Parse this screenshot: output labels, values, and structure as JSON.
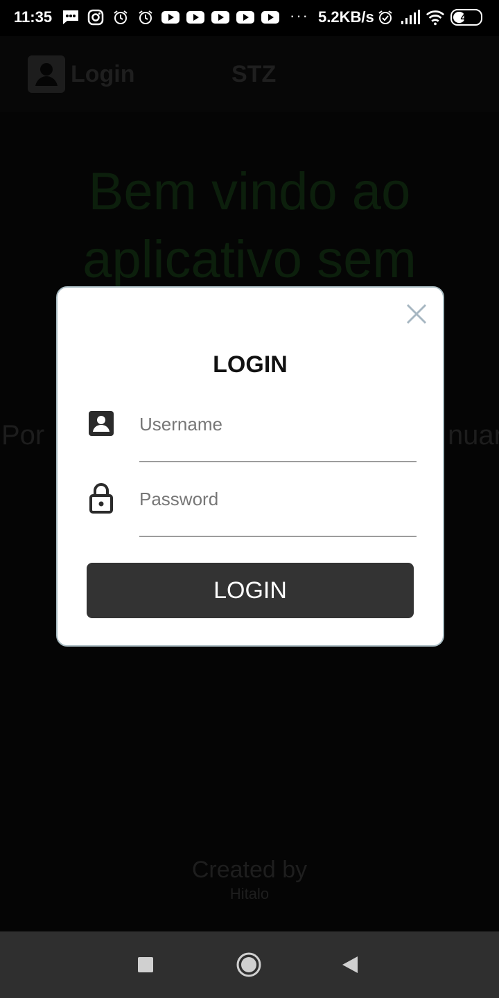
{
  "status_bar": {
    "time": "11:35",
    "network_speed": "5.2KB/s",
    "overflow": "···",
    "battery_level": "48",
    "notification_icons": [
      "message-icon",
      "instagram-icon",
      "alarm-icon",
      "alarm-icon",
      "youtube-icon",
      "youtube-icon",
      "youtube-icon",
      "youtube-icon",
      "youtube-icon"
    ]
  },
  "app": {
    "login_label": "Login",
    "title": "STZ",
    "welcome_line1": "Bem vindo ao",
    "welcome_line2": "aplicativo sem",
    "subtitle_left": "Por",
    "subtitle_right": "nuar",
    "credits_line1": "Created by",
    "credits_line2": "Hitalo"
  },
  "dialog": {
    "title": "LOGIN",
    "username_placeholder": "Username",
    "username_value": "",
    "password_placeholder": "Password",
    "password_value": "",
    "submit_label": "LOGIN"
  },
  "colors": {
    "dialog_background": "#ffffff",
    "dialog_border": "#a9bcc2",
    "button": "#333333",
    "scrim": "#050505",
    "welcome_text": "#0c1f0c",
    "nav_bar": "#2f2f2f"
  },
  "nav_bar": {
    "buttons": [
      "recents-square-icon",
      "home-circle-icon",
      "back-triangle-icon"
    ]
  }
}
